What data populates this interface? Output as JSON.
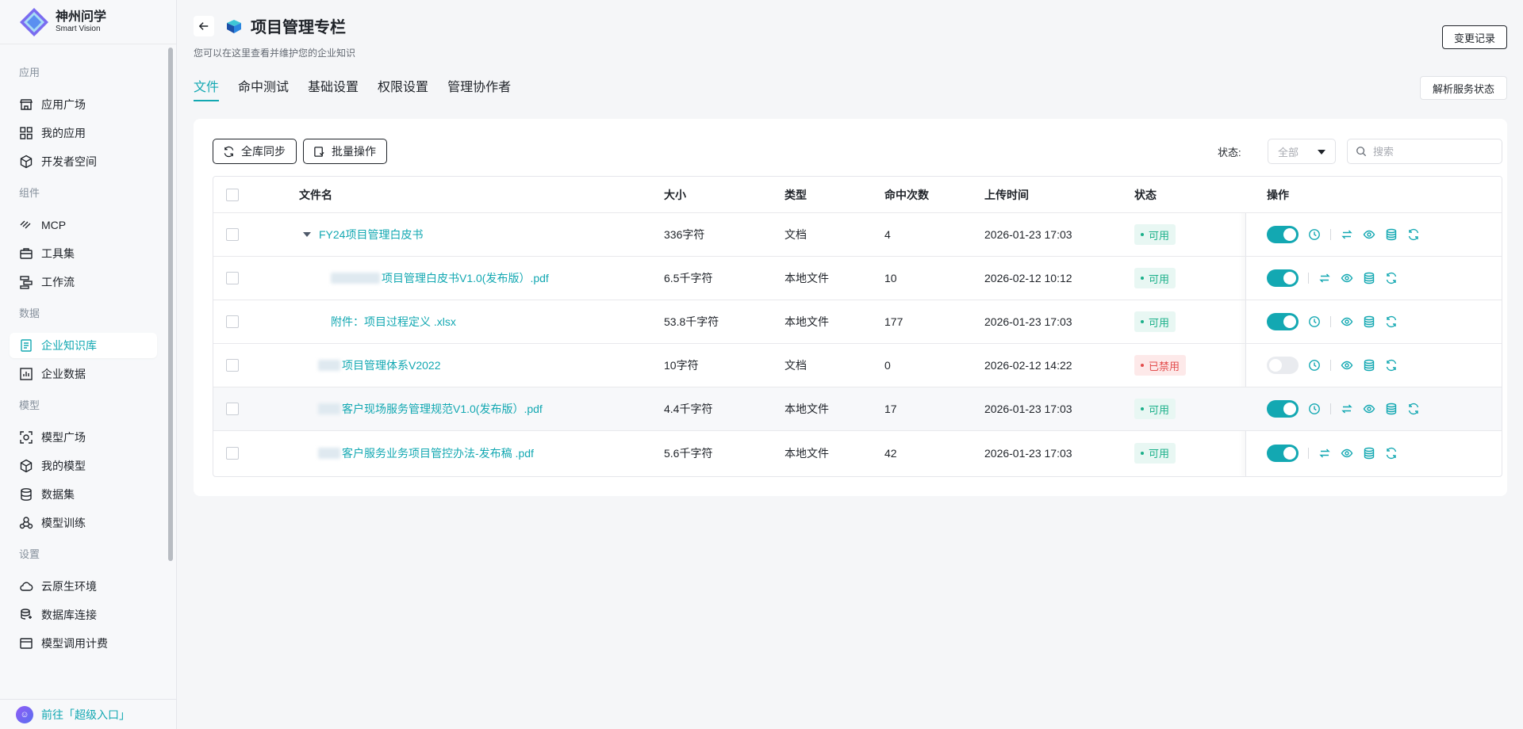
{
  "brand": {
    "name_cn": "神州问学",
    "name_en": "Smart Vision"
  },
  "sidebar": {
    "groups": [
      {
        "label": "应用",
        "items": [
          "应用广场",
          "我的应用",
          "开发者空间"
        ]
      },
      {
        "label": "组件",
        "items": [
          "MCP",
          "工具集",
          "工作流"
        ]
      },
      {
        "label": "数据",
        "items": [
          "企业知识库",
          "企业数据"
        ]
      },
      {
        "label": "模型",
        "items": [
          "模型广场",
          "我的模型",
          "数据集",
          "模型训练"
        ]
      },
      {
        "label": "设置",
        "items": [
          "云原生环境",
          "数据库连接",
          "模型调用计费"
        ]
      }
    ],
    "active_item": "企业知识库",
    "super_entry": "前往「超级入口」"
  },
  "header": {
    "title": "项目管理专栏",
    "subtitle": "您可以在这里查看并维护您的企业知识",
    "history_button": "变更记录",
    "parse_button": "解析服务状态"
  },
  "tabs": [
    "文件",
    "命中测试",
    "基础设置",
    "权限设置",
    "管理协作者"
  ],
  "active_tab": "文件",
  "toolbar": {
    "sync_button": "全库同步",
    "batch_button": "批量操作",
    "status_label": "状态:",
    "status_value": "全部",
    "search_placeholder": "搜索"
  },
  "table": {
    "columns": [
      "文件名",
      "大小",
      "类型",
      "命中次数",
      "上传时间",
      "状态",
      "操作"
    ],
    "rows": [
      {
        "name": "FY24项目管理白皮书",
        "size": "336字符",
        "type": "文档",
        "hits": "4",
        "time": "2026-01-23 17:03",
        "status": "可用",
        "enabled": true
      },
      {
        "name": "项目管理白皮书V1.0(发布版）.pdf",
        "size": "6.5千字符",
        "type": "本地文件",
        "hits": "10",
        "time": "2026-02-12 10:12",
        "status": "可用",
        "enabled": true
      },
      {
        "name": "附件：项目过程定义 .xlsx",
        "size": "53.8千字符",
        "type": "本地文件",
        "hits": "177",
        "time": "2026-01-23 17:03",
        "status": "可用",
        "enabled": true
      },
      {
        "name": "项目管理体系V2022",
        "size": "10字符",
        "type": "文档",
        "hits": "0",
        "time": "2026-02-12 14:22",
        "status": "已禁用",
        "enabled": false
      },
      {
        "name": "客户现场服务管理规范V1.0(发布版）.pdf",
        "size": "4.4千字符",
        "type": "本地文件",
        "hits": "17",
        "time": "2026-01-23 17:03",
        "status": "可用",
        "enabled": true
      },
      {
        "name": "客户服务业务项目管控办法-发布稿 .pdf",
        "size": "5.6千字符",
        "type": "本地文件",
        "hits": "42",
        "time": "2026-01-23 17:03",
        "status": "可用",
        "enabled": true
      }
    ]
  },
  "colors": {
    "accent": "#13a8b2",
    "ok": "#1bb08a",
    "danger": "#e34d4d"
  }
}
